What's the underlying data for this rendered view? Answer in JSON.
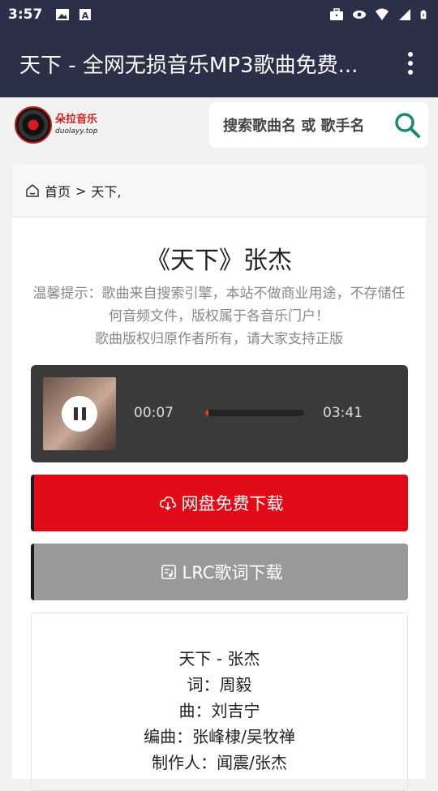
{
  "status_bar": {
    "time": "3:57",
    "left_icons": [
      "image-icon",
      "font-icon"
    ],
    "right_icons": [
      "briefcase-icon",
      "eye-icon",
      "wifi-icon",
      "signal-icon",
      "battery-icon"
    ]
  },
  "app_bar": {
    "title": "天下 - 全网无损音乐MP3歌曲免费...",
    "menu_icon": "more-vert-icon"
  },
  "site_header": {
    "logo_cn": "朵拉音乐",
    "logo_en": "duolayy.top",
    "search_placeholder": "搜索歌曲名 或 歌手名",
    "search_icon": "search-icon"
  },
  "breadcrumb": {
    "home_icon": "home-icon",
    "home": "首页",
    "separator": ">",
    "current": "天下,"
  },
  "song": {
    "title": "《天下》张杰",
    "notice_line1": "温馨提示：歌曲来自搜索引擎，本站不做商业用途，不存储任何音频文件，版权属于各音乐门户！",
    "notice_line2": "歌曲版权归原作者所有，请大家支持正版"
  },
  "player": {
    "current_time": "00:07",
    "total_time": "03:41",
    "progress_fraction": 0.03,
    "state": "playing",
    "pause_icon": "pause-icon"
  },
  "buttons": {
    "download": "网盘免费下载",
    "download_icon": "cloud-download-icon",
    "lrc": "LRC歌词下载",
    "lrc_icon": "lyrics-file-icon"
  },
  "lyrics": [
    "天下 - 张杰",
    "词：周毅",
    "曲：刘吉宁",
    "编曲：张峰棣/吴牧禅",
    "制作人：闻震/张杰"
  ],
  "colors": {
    "app_bar": "#2b2f47",
    "download_button": "#e20a16",
    "lrc_button": "#999999",
    "search_icon": "#1a8a6e"
  }
}
